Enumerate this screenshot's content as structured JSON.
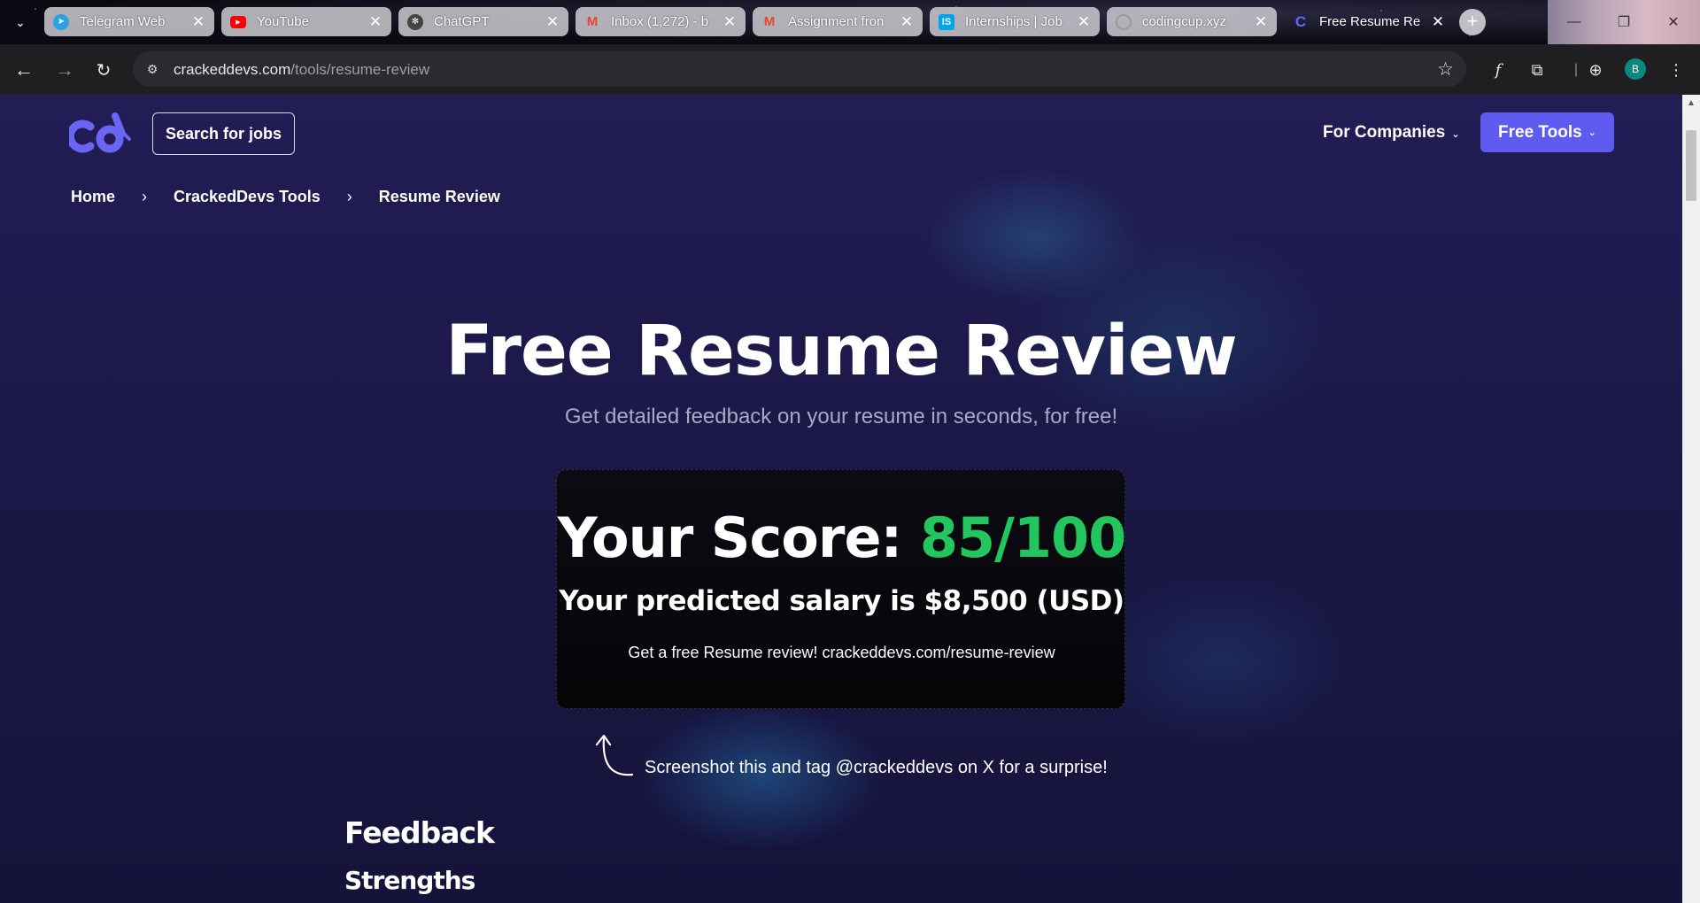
{
  "browser": {
    "tabs": [
      {
        "title": "Telegram Web",
        "favicon": "telegram-icon",
        "color": "#2aa3e0",
        "glyph": "➤"
      },
      {
        "title": "YouTube",
        "favicon": "youtube-icon",
        "color": "#ff0000",
        "glyph": "▶"
      },
      {
        "title": "ChatGPT",
        "favicon": "chatgpt-icon",
        "color": "#444444",
        "glyph": "✻"
      },
      {
        "title": "Inbox (1,272) - b",
        "favicon": "gmail-icon",
        "color": "#ea4335",
        "glyph": "M"
      },
      {
        "title": "Assignment fron",
        "favicon": "gmail-icon",
        "color": "#ea4335",
        "glyph": "M"
      },
      {
        "title": "Internships | Job",
        "favicon": "internshala-icon",
        "color": "#00a5ec",
        "glyph": "IS"
      },
      {
        "title": "codingcup.xyz",
        "favicon": "globe-icon",
        "color": "#777777",
        "glyph": "◌"
      },
      {
        "title": "Free Resume Re",
        "favicon": "crackeddevs-icon",
        "color": "#5f5af0",
        "glyph": "C"
      }
    ],
    "url_host": "crackeddevs.com",
    "url_path": "/tools/resume-review",
    "profile_initial": "B"
  },
  "nav": {
    "search_jobs": "Search for jobs",
    "for_companies": "For Companies",
    "free_tools": "Free Tools"
  },
  "breadcrumb": {
    "home": "Home",
    "tools": "CrackedDevs Tools",
    "current": "Resume Review"
  },
  "hero": {
    "title": "Free Resume Review",
    "subtitle": "Get detailed feedback on your resume in seconds, for free!"
  },
  "score_card": {
    "score_label": "Your Score:",
    "score_value": "85/100",
    "salary_text": "Your predicted salary is $8,500 (USD)",
    "promo_text": "Get a free Resume review! crackeddevs.com/resume-review"
  },
  "share_text": "Screenshot this and tag @crackeddevs on X for a surprise!",
  "sections": {
    "feedback": "Feedback",
    "strengths": "Strengths"
  },
  "colors": {
    "accent": "#5f5af0",
    "score_green": "#22c55e",
    "page_bg": "#1c1848"
  }
}
